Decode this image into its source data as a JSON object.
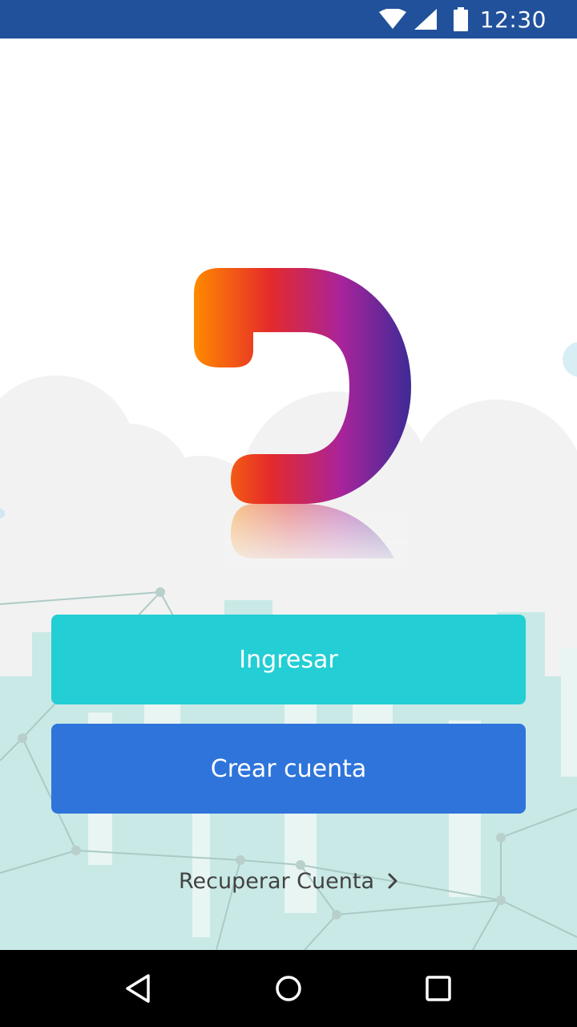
{
  "status_bar": {
    "time": "12:30",
    "background": "#21519b",
    "icons": [
      "wifi-icon",
      "cell-signal-icon",
      "battery-icon"
    ]
  },
  "logo": {
    "name": "brand-logo",
    "colors": [
      "#ff8a00",
      "#e52a2a",
      "#a8239b",
      "#3d2b96"
    ]
  },
  "actions": {
    "login_label": "Ingresar",
    "login_color": "#23ced4",
    "create_label": "Crear cuenta",
    "create_color": "#2e74db",
    "recover_label": "Recuperar Cuenta",
    "recover_icon": "chevron-right-icon"
  },
  "nav_bar": {
    "buttons": [
      "back-icon",
      "home-icon",
      "recents-icon"
    ]
  }
}
